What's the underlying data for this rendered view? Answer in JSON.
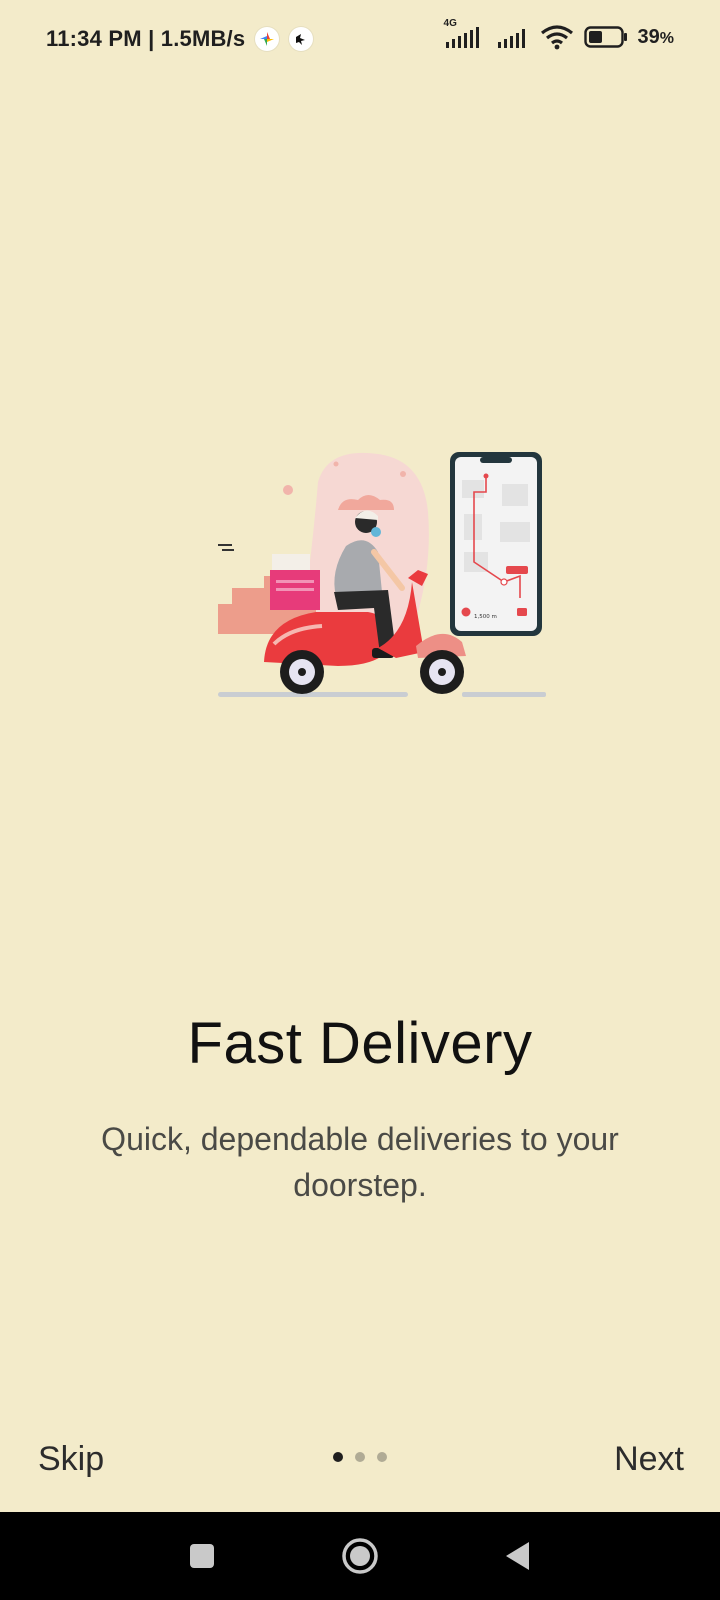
{
  "status_bar": {
    "time": "11:34 PM",
    "network_speed": "1.5MB/s",
    "signal_label": "4G",
    "battery_percent": "39",
    "battery_unit": "%",
    "icons": [
      "photos-icon",
      "bird-icon",
      "signal-icon",
      "signal-icon",
      "wifi-icon",
      "battery-icon"
    ]
  },
  "onboarding": {
    "title": "Fast Delivery",
    "description": "Quick, dependable deliveries to your doorstep.",
    "page_indicator": {
      "current": 1,
      "total": 3
    },
    "skip_label": "Skip",
    "next_label": "Next",
    "illustration": "scooter-delivery-illustration",
    "illustration_phone_text": "1,500 m"
  },
  "nav_bar": {
    "buttons": [
      "recents-button",
      "home-button",
      "back-button"
    ]
  },
  "colors": {
    "background": "#f3ebca",
    "title_text": "#111111",
    "description_text": "#4a4a46",
    "dot_active": "#1f1f1f",
    "dot_inactive": "#b0ab95",
    "nav_bar": "#000000"
  }
}
